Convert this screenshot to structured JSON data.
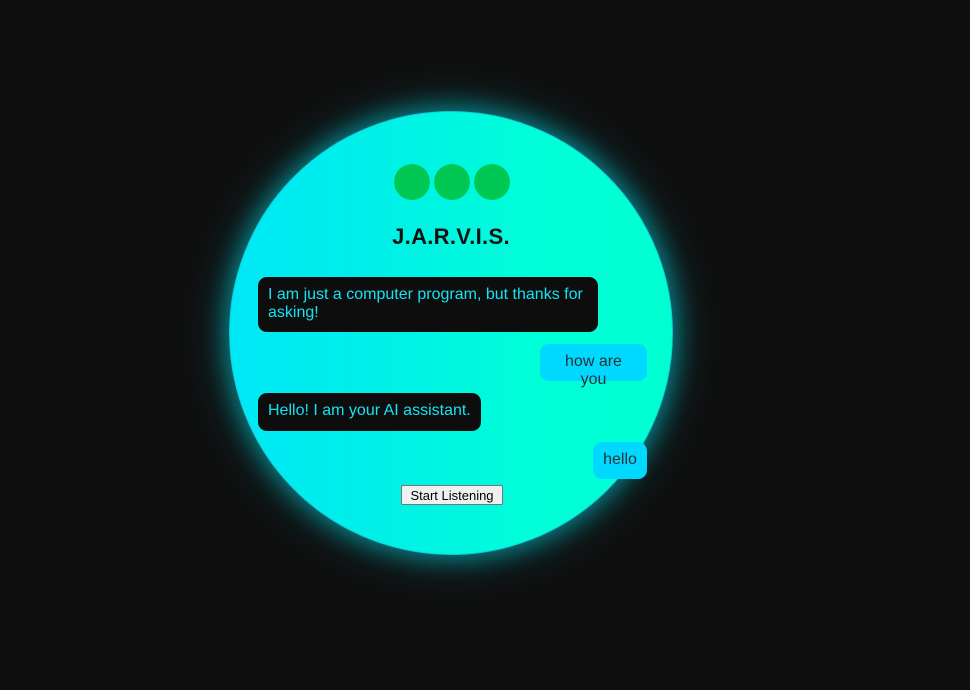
{
  "assistant": {
    "title": "J.A.R.V.I.S.",
    "indicator_dots": 3
  },
  "messages": [
    {
      "sender": "bot",
      "text": "I am just a computer program, but thanks for asking!"
    },
    {
      "sender": "user",
      "text": "how are you"
    },
    {
      "sender": "bot",
      "text": "Hello! I am your AI assistant."
    },
    {
      "sender": "user",
      "text": "hello"
    }
  ],
  "controls": {
    "listen_label": "Start Listening"
  },
  "colors": {
    "background": "#0f0f0f",
    "orb_gradient_start": "#00e8f6",
    "orb_gradient_end": "#00ffd0",
    "indicator_dot": "#00c853",
    "bot_bubble": "#0d0d0d",
    "bot_text": "#14e3f3",
    "user_bubble": "#00d9ff",
    "user_text": "#243236"
  }
}
